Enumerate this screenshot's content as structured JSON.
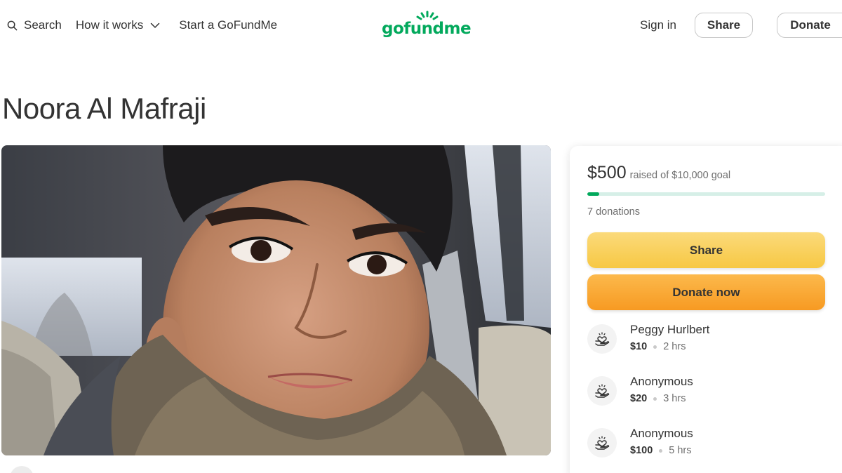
{
  "header": {
    "search_label": "Search",
    "how_it_works_label": "How it works",
    "start_label": "Start a GoFundMe",
    "logo_text": "gofundme",
    "signin_label": "Sign in",
    "share_label": "Share",
    "donate_label": "Donate",
    "brand_color": "#02a95c"
  },
  "campaign": {
    "title": "Noora Al Mafraji",
    "raised_amount": "$500",
    "raised_of_goal": "raised of $10,000 goal",
    "progress_fraction": 0.05,
    "donations_count": "7 donations",
    "share_button": "Share",
    "donate_button": "Donate now",
    "share_color": "#f7c843",
    "donate_color": "#f79a22"
  },
  "donors": [
    {
      "name": "Peggy Hurlbert",
      "amount": "$10",
      "time": "2 hrs"
    },
    {
      "name": "Anonymous",
      "amount": "$20",
      "time": "3 hrs"
    },
    {
      "name": "Anonymous",
      "amount": "$100",
      "time": "5 hrs"
    }
  ],
  "icons": {
    "search": "search-icon",
    "chevron": "chevron-down-icon",
    "donor": "heart-hand-icon"
  }
}
